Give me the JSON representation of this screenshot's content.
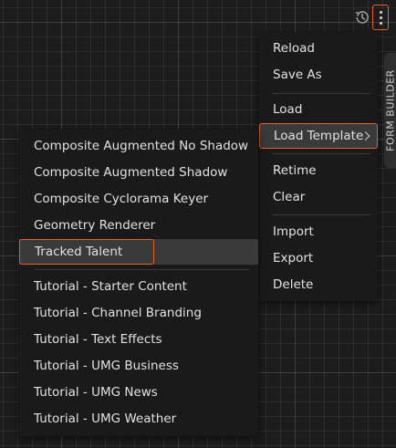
{
  "toolbar": {
    "history_icon": "history-icon",
    "more_icon": "kebab-menu-icon"
  },
  "side_tab": {
    "label": "FORM BUILDER"
  },
  "main_menu": {
    "items": [
      {
        "label": "Reload"
      },
      {
        "label": "Save As"
      },
      {
        "label": "Load"
      },
      {
        "label": "Load Template"
      },
      {
        "label": "Retime"
      },
      {
        "label": "Clear"
      },
      {
        "label": "Import"
      },
      {
        "label": "Export"
      },
      {
        "label": "Delete"
      }
    ]
  },
  "template_menu": {
    "items": [
      {
        "label": "Composite Augmented No Shadow"
      },
      {
        "label": "Composite Augmented Shadow"
      },
      {
        "label": "Composite Cyclorama Keyer"
      },
      {
        "label": "Geometry Renderer"
      },
      {
        "label": "Tracked Talent"
      },
      {
        "label": "Tutorial - Starter Content"
      },
      {
        "label": "Tutorial - Channel Branding"
      },
      {
        "label": "Tutorial - Text Effects"
      },
      {
        "label": "Tutorial - UMG Business"
      },
      {
        "label": "Tutorial - UMG News"
      },
      {
        "label": "Tutorial - UMG Weather"
      }
    ]
  },
  "colors": {
    "accent": "#e2622c",
    "menu_bg": "#1a1a1a",
    "highlight_bg": "#3a3a3a",
    "canvas_bg": "#1c1c1c"
  }
}
